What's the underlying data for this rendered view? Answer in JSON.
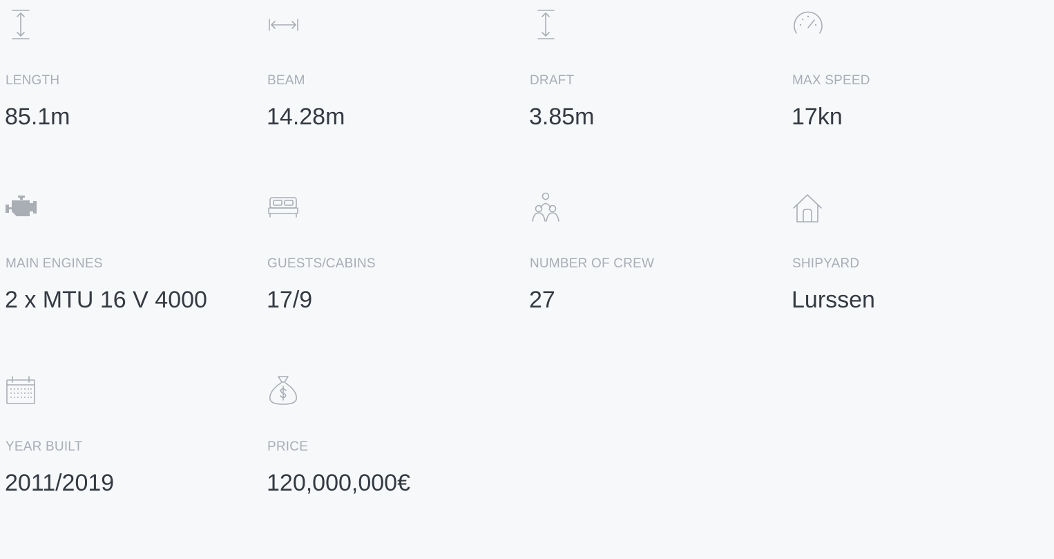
{
  "specs": [
    {
      "label": "LENGTH",
      "value": "85.1m",
      "icon": "length-icon"
    },
    {
      "label": "BEAM",
      "value": "14.28m",
      "icon": "beam-icon"
    },
    {
      "label": "DRAFT",
      "value": "3.85m",
      "icon": "draft-icon"
    },
    {
      "label": "MAX SPEED",
      "value": "17kn",
      "icon": "speedometer-icon"
    },
    {
      "label": "MAIN ENGINES",
      "value": "2 x MTU 16 V 4000",
      "icon": "engine-icon"
    },
    {
      "label": "GUESTS/CABINS",
      "value": "17/9",
      "icon": "bed-icon"
    },
    {
      "label": "NUMBER OF CREW",
      "value": "27",
      "icon": "crew-icon"
    },
    {
      "label": "SHIPYARD",
      "value": "Lurssen",
      "icon": "house-icon"
    },
    {
      "label": "YEAR BUILT",
      "value": "2011/2019",
      "icon": "calendar-icon"
    },
    {
      "label": "PRICE",
      "value": "120,000,000€",
      "icon": "money-bag-icon"
    }
  ],
  "colors": {
    "background": "#f7f8fa",
    "label": "#a7adb5",
    "value": "#343a42",
    "icon": "#a9aeb5"
  }
}
